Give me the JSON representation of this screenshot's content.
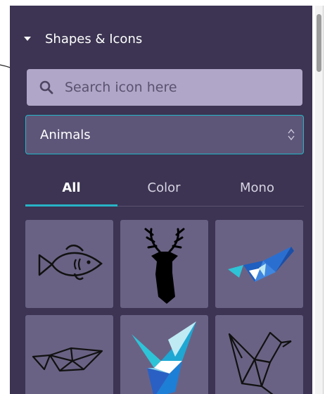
{
  "panel": {
    "section_title": "Shapes & Icons",
    "search": {
      "placeholder": "Search icon here",
      "value": ""
    },
    "category_select": {
      "selected": "Animals"
    },
    "tabs": [
      {
        "label": "All",
        "active": true
      },
      {
        "label": "Color",
        "active": false
      },
      {
        "label": "Mono",
        "active": false
      }
    ],
    "icons": [
      {
        "name": "fish-icon",
        "style": "mono"
      },
      {
        "name": "deer-head-icon",
        "style": "mono"
      },
      {
        "name": "origami-whale-icon",
        "style": "color"
      },
      {
        "name": "origami-whale-outline-icon",
        "style": "mono"
      },
      {
        "name": "origami-bird-icon",
        "style": "color"
      },
      {
        "name": "origami-bird-outline-icon",
        "style": "mono"
      }
    ]
  },
  "colors": {
    "panel_bg": "#3c3452",
    "search_bg": "#b0a6c7",
    "select_bg": "#5e5678",
    "accent": "#27b4c6",
    "tile_bg": "#6a6284"
  }
}
